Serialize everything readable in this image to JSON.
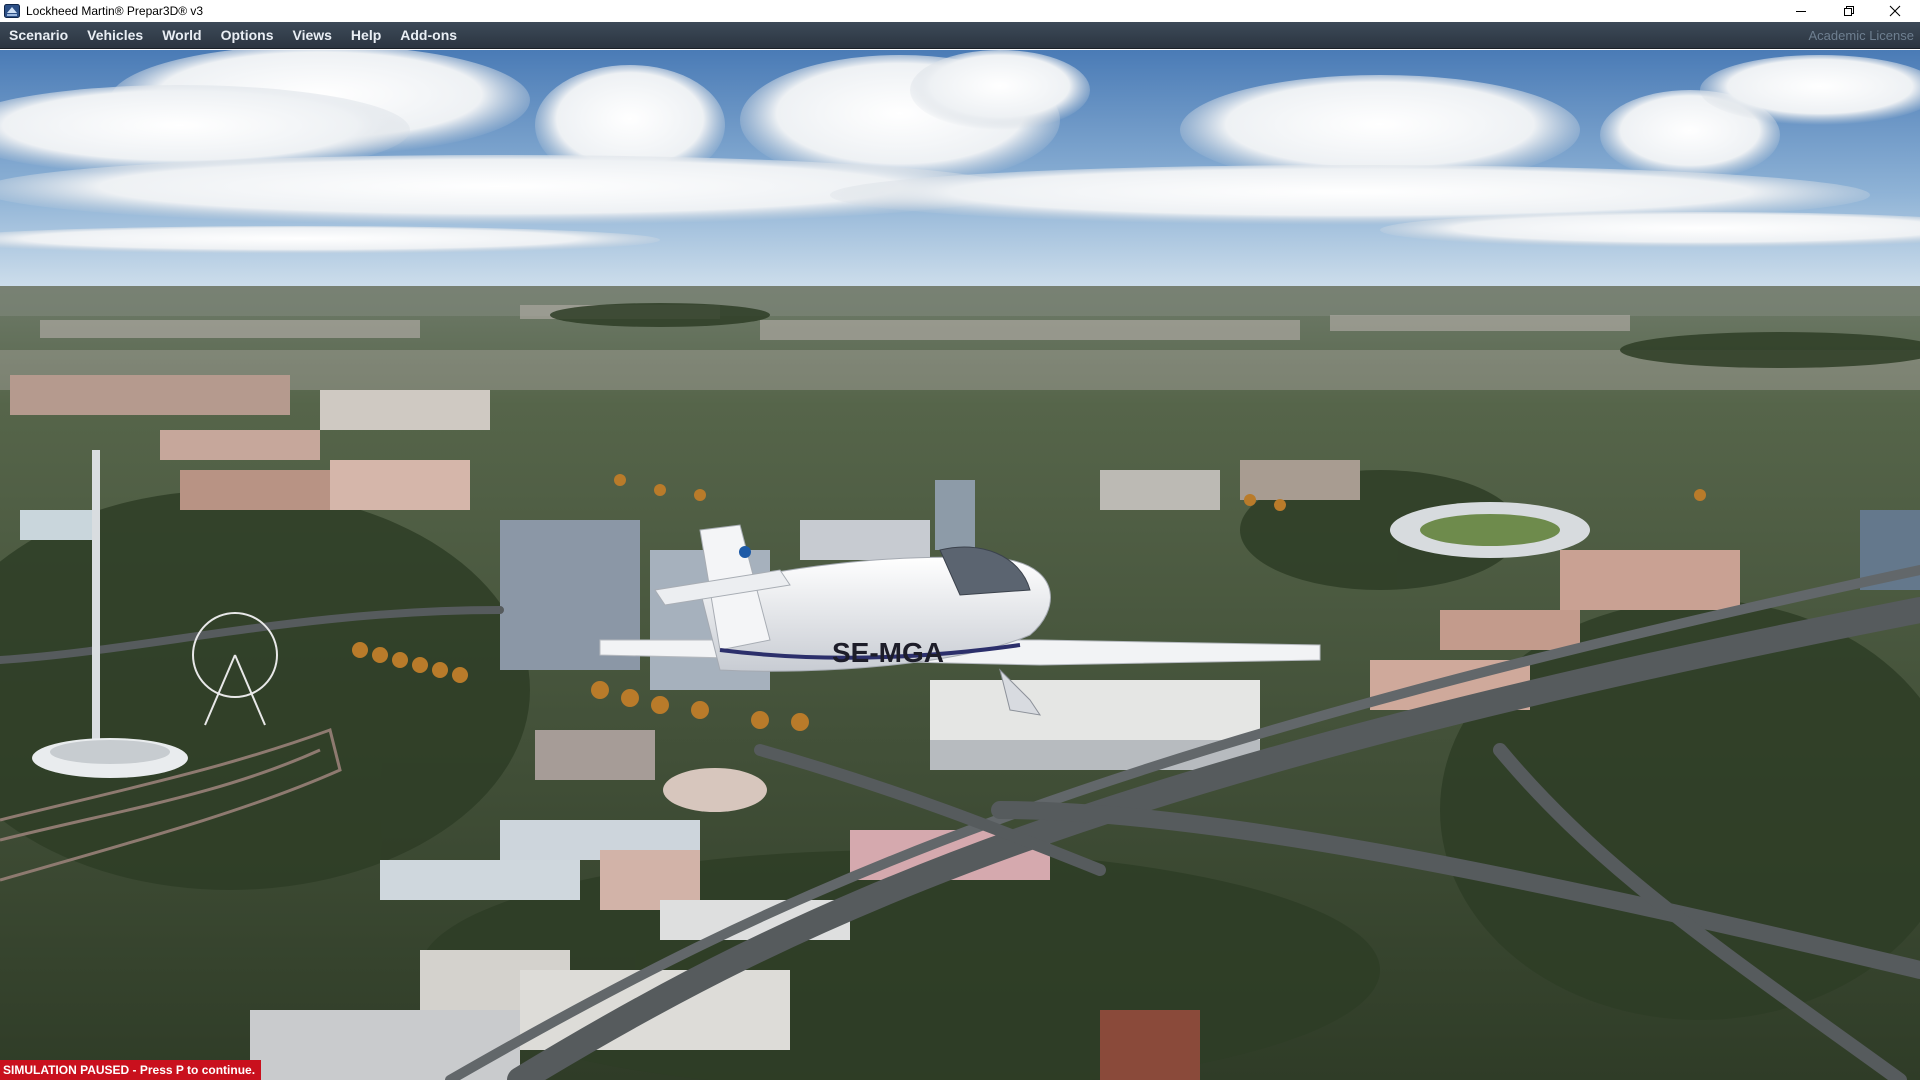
{
  "window": {
    "title": "Lockheed Martin® Prepar3D® v3"
  },
  "menu": {
    "items": [
      {
        "label": "Scenario"
      },
      {
        "label": "Vehicles"
      },
      {
        "label": "World"
      },
      {
        "label": "Options"
      },
      {
        "label": "Views"
      },
      {
        "label": "Help"
      },
      {
        "label": "Add-ons"
      }
    ],
    "license": "Academic License"
  },
  "scene": {
    "aircraft_registration": "SE-MGA",
    "description_icons": [
      "minimize-icon",
      "restore-icon",
      "close-icon"
    ]
  },
  "status": {
    "text": "SIMULATION PAUSED - Press P to continue."
  },
  "colors": {
    "menubar": "#2f3a47",
    "status_bg": "#c9101d",
    "sky_top": "#4f7fb8",
    "sky_bottom": "#c9dceb",
    "ground": "#3b4a32"
  }
}
